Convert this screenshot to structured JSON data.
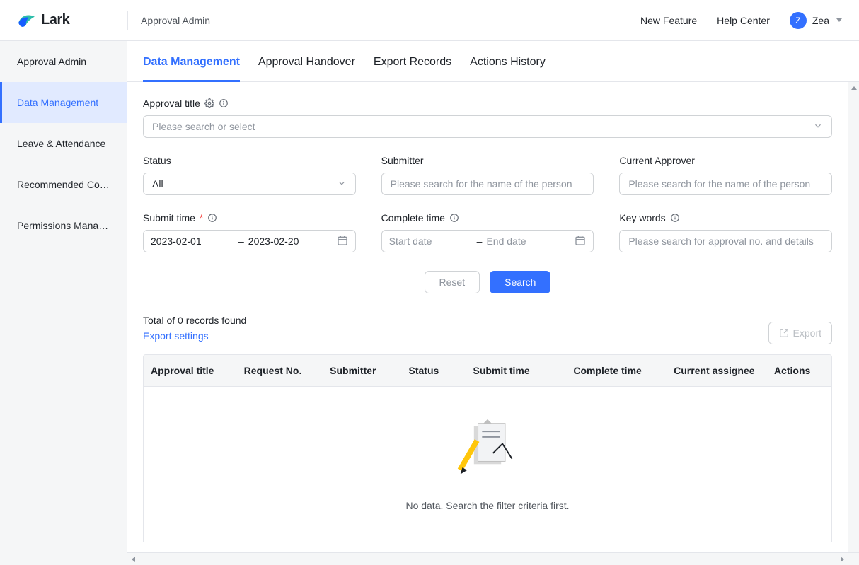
{
  "brand": {
    "name": "Lark"
  },
  "topbar": {
    "title": "Approval Admin",
    "links": {
      "new_feature": "New Feature",
      "help_center": "Help Center"
    },
    "user": {
      "initial": "Z",
      "name": "Zea"
    }
  },
  "sidebar": {
    "items": [
      {
        "label": "Approval Admin",
        "active": false
      },
      {
        "label": "Data Management",
        "active": true
      },
      {
        "label": "Leave & Attendance",
        "active": false
      },
      {
        "label": "Recommended Confi...",
        "active": false
      },
      {
        "label": "Permissions Manage...",
        "active": false
      }
    ]
  },
  "tabs": [
    {
      "label": "Data Management",
      "active": true
    },
    {
      "label": "Approval Handover",
      "active": false
    },
    {
      "label": "Export Records",
      "active": false
    },
    {
      "label": "Actions History",
      "active": false
    }
  ],
  "filters": {
    "approval_title": {
      "label": "Approval title",
      "placeholder": "Please search or select"
    },
    "status": {
      "label": "Status",
      "value": "All"
    },
    "submitter": {
      "label": "Submitter",
      "placeholder": "Please search for the name of the person"
    },
    "current_approver": {
      "label": "Current Approver",
      "placeholder": "Please search for the name of the person"
    },
    "submit_time": {
      "label": "Submit time",
      "required": true,
      "start": "2023-02-01",
      "sep": "–",
      "end": "2023-02-20"
    },
    "complete_time": {
      "label": "Complete time",
      "start_ph": "Start date",
      "sep": "–",
      "end_ph": "End date"
    },
    "key_words": {
      "label": "Key words",
      "placeholder": "Please search for approval no. and details"
    }
  },
  "buttons": {
    "reset": "Reset",
    "search": "Search",
    "export": "Export"
  },
  "results": {
    "total_text": "Total of 0 records found",
    "export_settings": "Export settings",
    "columns": [
      "Approval title",
      "Request No.",
      "Submitter",
      "Status",
      "Submit time",
      "Complete time",
      "Current assignee",
      "Actions"
    ],
    "empty_text": "No data. Search the filter criteria first."
  }
}
